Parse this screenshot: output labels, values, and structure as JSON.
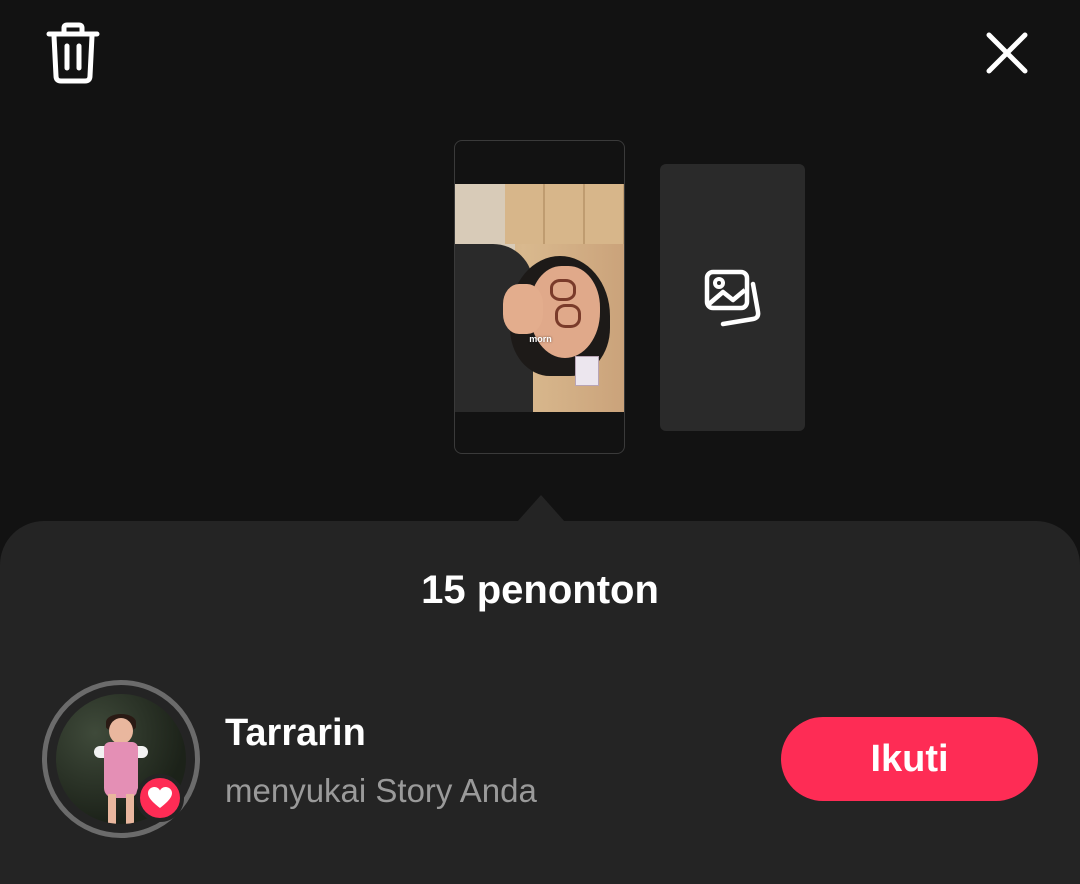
{
  "toolbar": {
    "delete_icon": "trash-icon",
    "close_icon": "close-icon"
  },
  "story": {
    "caption": "morn",
    "add_icon": "gallery-icon"
  },
  "viewers": {
    "title": "15 penonton",
    "items": [
      {
        "name": "Tarrarin",
        "subtitle": "menyukai Story Anda",
        "badge_icon": "heart-icon",
        "follow_label": "Ikuti"
      }
    ]
  },
  "colors": {
    "background": "#121212",
    "sheet": "#242424",
    "accent": "#fe2c55",
    "secondary_text": "#9a9a9a"
  }
}
